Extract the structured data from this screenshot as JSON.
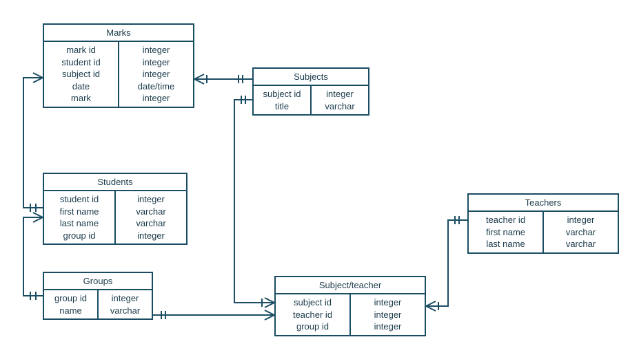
{
  "entities": {
    "marks": {
      "title": "Marks",
      "fields": "mark id\nstudent id\nsubject id\ndate\nmark",
      "types": "integer\ninteger\ninteger\ndate/time\ninteger"
    },
    "subjects": {
      "title": "Subjects",
      "fields": "subject id\ntitle",
      "types": "integer\nvarchar"
    },
    "students": {
      "title": "Students",
      "fields": "student id\nfirst name\nlast name\ngroup id",
      "types": "integer\nvarchar\nvarchar\ninteger"
    },
    "teachers": {
      "title": "Teachers",
      "fields": "teacher id\nfirst name\nlast name",
      "types": "integer\nvarchar\nvarchar"
    },
    "groups": {
      "title": "Groups",
      "fields": "group id\nname",
      "types": "integer\nvarchar"
    },
    "subject_teacher": {
      "title": "Subject/teacher",
      "fields": "subject id\nteacher id\ngroup id",
      "types": "integer\ninteger\ninteger"
    }
  }
}
